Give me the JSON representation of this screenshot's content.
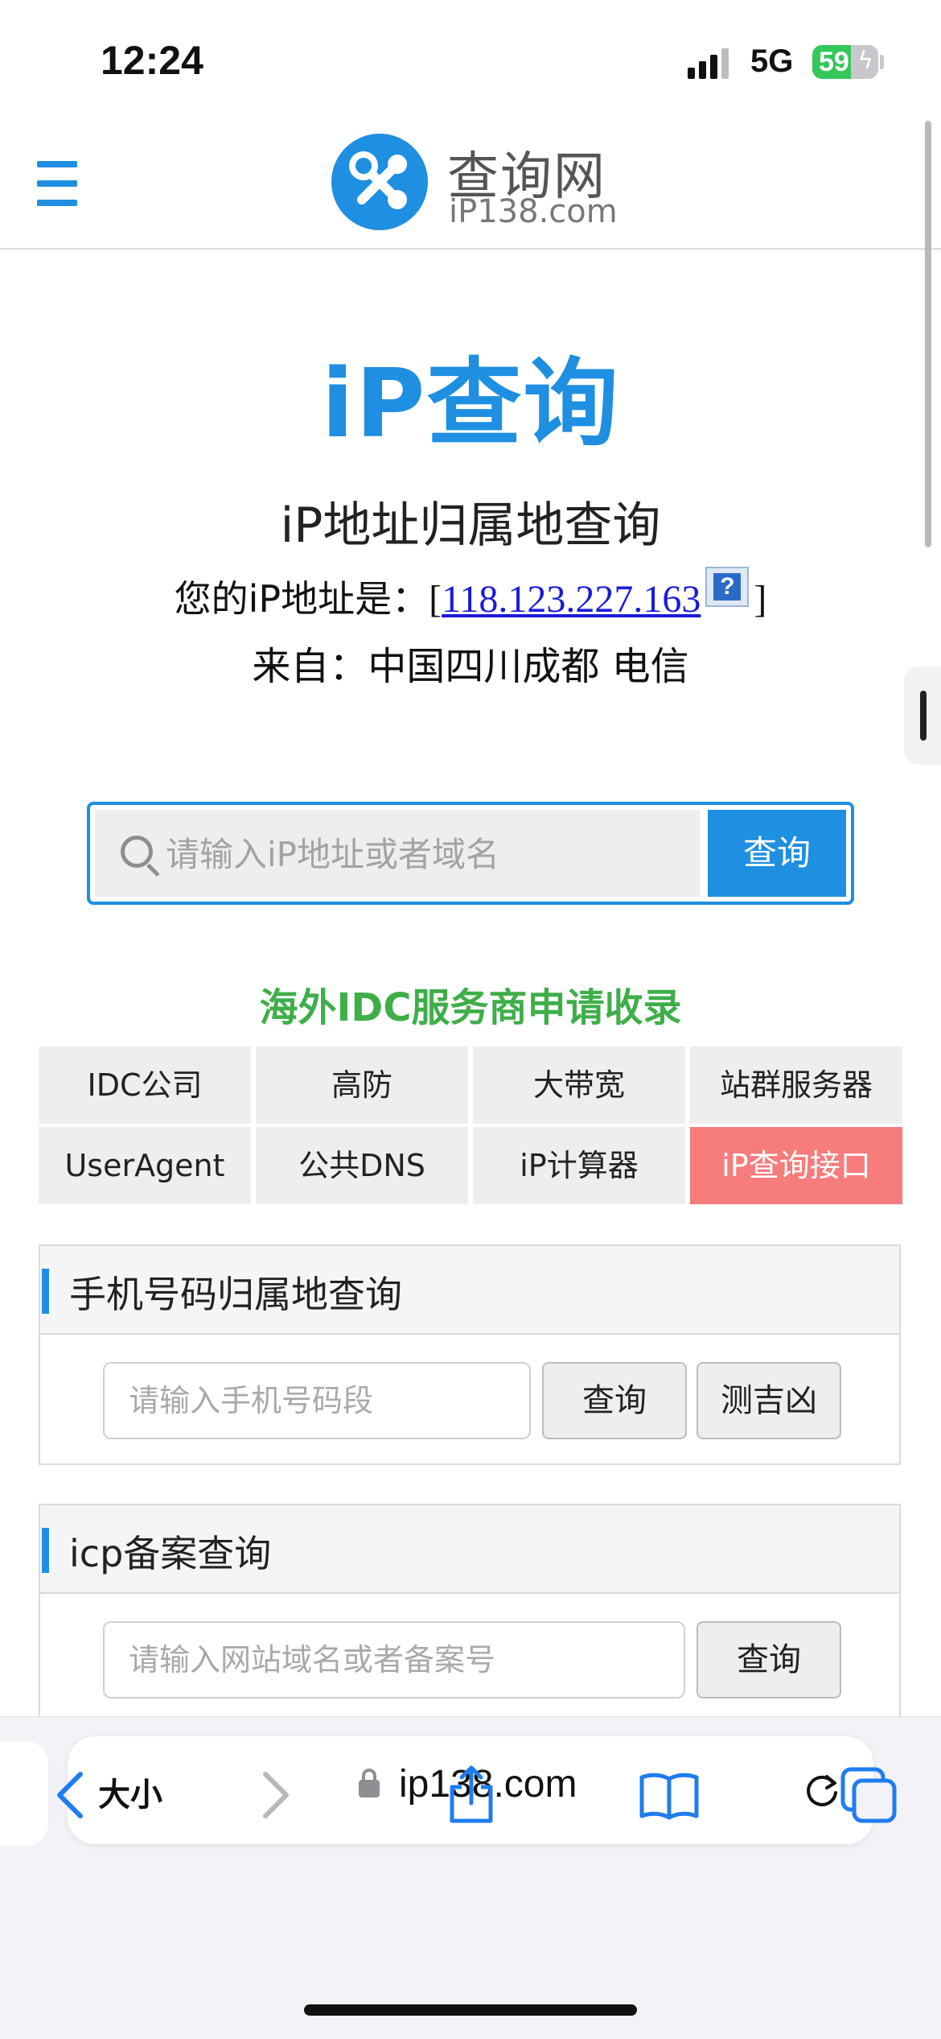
{
  "status_bar": {
    "time": "12:24",
    "network": "5G",
    "battery": "59",
    "battery_level": 0.59
  },
  "header": {
    "logo_title": "查询网",
    "logo_sub": "iP138.com"
  },
  "main": {
    "big_title": "iP查询",
    "subtitle": "iP地址归属地查询",
    "ip_prefix": "您的iP地址是：",
    "ip_bracket_open": "[",
    "ip_address": "118.123.227.163",
    "ip_bracket_close": "]",
    "help_glyph": "?",
    "location": "来自：中国四川成都 电信"
  },
  "search": {
    "placeholder": "请输入iP地址或者域名",
    "button": "查询"
  },
  "promo": "海外IDC服务商申请收录",
  "grid": [
    "IDC公司",
    "高防",
    "大带宽",
    "站群服务器",
    "UserAgent",
    "公共DNS",
    "iP计算器",
    "iP查询接口"
  ],
  "phone_panel": {
    "title": "手机号码归属地查询",
    "placeholder": "请输入手机号码段",
    "query_button": "查询",
    "fortune_button": "测吉凶"
  },
  "icp_panel": {
    "title": "icp备案查询",
    "placeholder": "请输入网站域名或者备案号",
    "query_button": "查询"
  },
  "browser": {
    "text_size": "大小",
    "url": "ip138.com"
  },
  "colors": {
    "accent": "#1e8fe1",
    "promo": "#3fae49",
    "hot": "#f77c7c"
  }
}
